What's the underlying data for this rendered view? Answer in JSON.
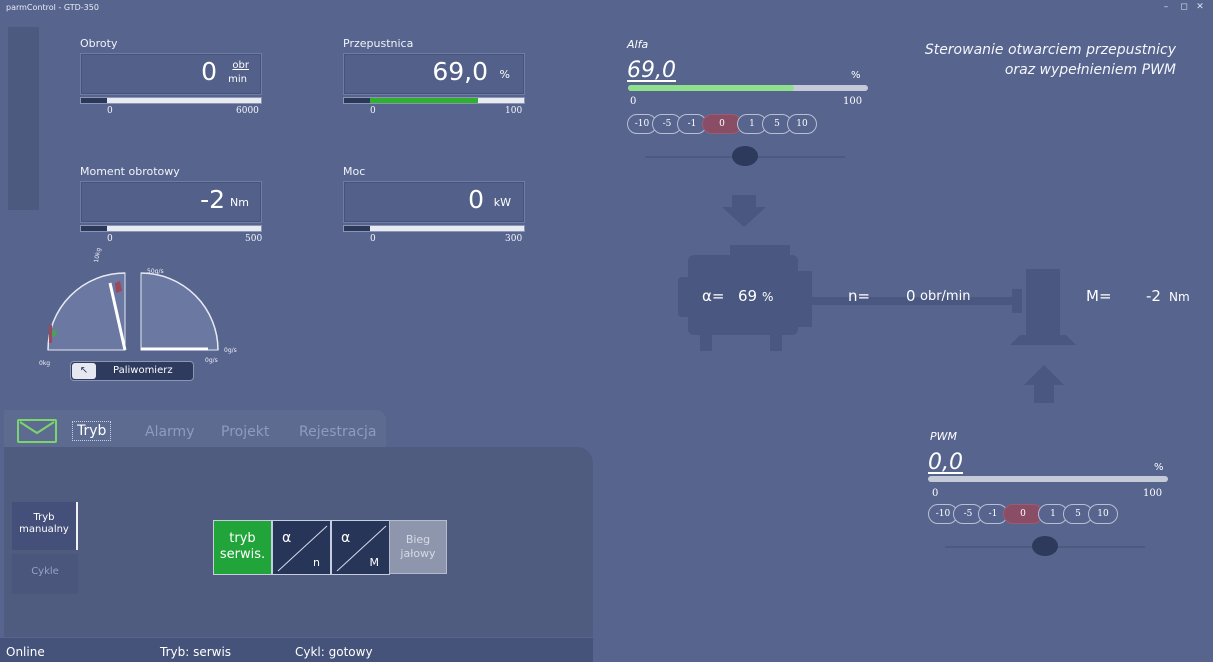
{
  "window": {
    "title": "parmControl - GTD-350",
    "controls": [
      "–",
      "◻",
      "✕"
    ]
  },
  "gauges": [
    {
      "label": "Obroty",
      "value": "0",
      "unit_top": "obr",
      "unit_bottom": "min",
      "min": "0",
      "max": "6000",
      "fill": 0
    },
    {
      "label": "Przepustnica",
      "value": "69,0",
      "unit": "%",
      "min": "0",
      "max": "100",
      "fill": 0.69
    },
    {
      "label": "Moment obrotowy",
      "value": "-2",
      "unit": "Nm",
      "min": "0",
      "max": "500",
      "fill": 0
    },
    {
      "label": "Moc",
      "value": "0",
      "unit": "kW",
      "min": "0",
      "max": "300",
      "fill": 0
    }
  ],
  "fuel": {
    "left_top": "10kg",
    "left_bottom": "0kg",
    "right_top": "50g/s",
    "right_bottom": "0g/s",
    "right_bottom2": "0g/s",
    "button": "Paliwomierz",
    "left_level": 0.95,
    "right_level": 0
  },
  "tabs": {
    "items": [
      "Tryb",
      "Alarmy",
      "Projekt",
      "Rejestracja"
    ],
    "active": "Tryb"
  },
  "side_nav": {
    "active_line1": "Tryb",
    "active_line2": "manualny",
    "inactive": "Cykle"
  },
  "mode_buttons": {
    "service_line1": "tryb",
    "service_line2": "serwis.",
    "alpha_n_top": "α",
    "alpha_n_bottom": "n",
    "alpha_m_top": "α",
    "alpha_m_bottom": "M",
    "idle_line1": "Bieg",
    "idle_line2": "jałowy"
  },
  "status": {
    "online": "Online",
    "mode": "Tryb:  serwis",
    "cycle": "Cykl:  gotowy"
  },
  "right": {
    "title_line1": "Sterowanie otwarciem przepustnicy",
    "title_line2": "oraz wypełnieniem PWM"
  },
  "alfa": {
    "label": "Alfa",
    "value": "69,0",
    "unit": "%",
    "min": "0",
    "max": "100",
    "fill": 0.69,
    "steps": [
      "-10",
      "-5",
      "-1",
      "0",
      "1",
      "5",
      "10"
    ]
  },
  "pwm": {
    "label": "PWM",
    "value": "0,0",
    "unit": "%",
    "min": "0",
    "max": "100",
    "fill": 0,
    "steps": [
      "-10",
      "-5",
      "-1",
      "0",
      "1",
      "5",
      "10"
    ]
  },
  "schematic": {
    "alpha_label": "α=",
    "alpha_value": "69",
    "alpha_unit": "%",
    "n_label": "n=",
    "n_value": "0",
    "n_unit": "obr/min",
    "m_label": "M=",
    "m_value": "-2",
    "m_unit": "Nm"
  }
}
